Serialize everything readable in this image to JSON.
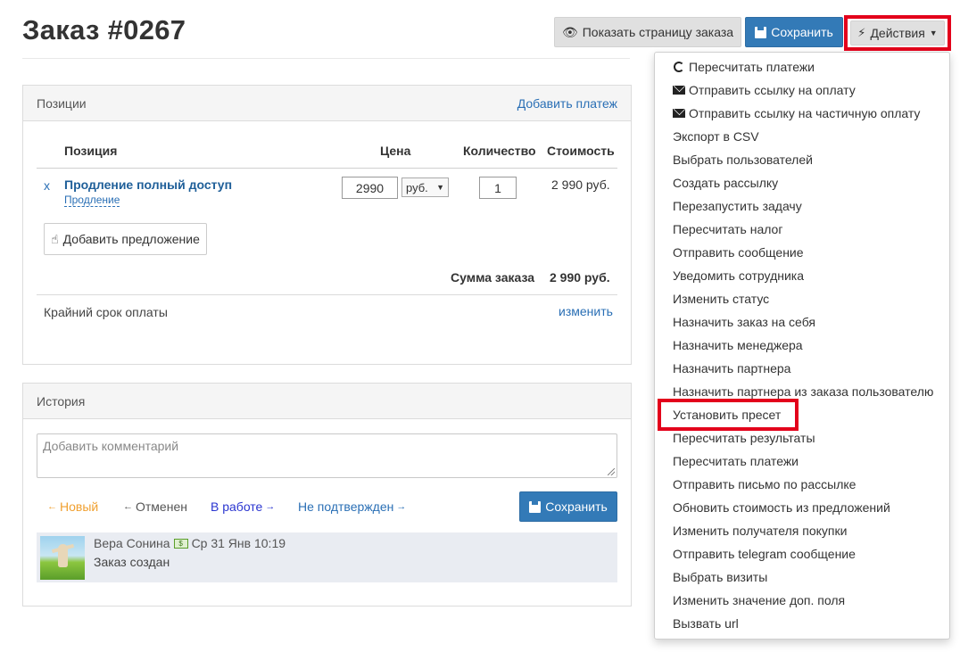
{
  "header": {
    "title": "Заказ #0267",
    "show_page_button": "Показать страницу заказа",
    "save_button": "Сохранить",
    "actions_button": "Действия"
  },
  "positions_panel": {
    "title": "Позиции",
    "add_payment_link": "Добавить платеж",
    "columns": {
      "position": "Позиция",
      "price": "Цена",
      "quantity": "Количество",
      "cost": "Стоимость"
    },
    "row": {
      "remove": "x",
      "name": "Продление полный доступ",
      "sub": "Продление",
      "price": "2990",
      "currency": "руб.",
      "quantity": "1",
      "cost": "2 990 руб."
    },
    "add_offer_button": "Добавить предложение",
    "total_label": "Сумма заказа",
    "total_value": "2 990 руб.",
    "deadline_label": "Крайний срок оплаты",
    "deadline_change": "изменить"
  },
  "history_panel": {
    "title": "История",
    "comment_placeholder": "Добавить комментарий",
    "statuses": {
      "new": "Новый",
      "cancelled": "Отменен",
      "in_progress": "В работе",
      "unconfirmed": "Не подтвержден"
    },
    "save_button": "Сохранить",
    "entry": {
      "author": "Вера Сонина",
      "time": "Ср 31 Янв 10:19",
      "text": "Заказ создан"
    }
  },
  "actions_menu": [
    "Пересчитать платежи",
    "Отправить ссылку на оплату",
    "Отправить ссылку на частичную оплату",
    "Экспорт в CSV",
    "Выбрать пользователей",
    "Создать рассылку",
    "Перезапустить задачу",
    "Пересчитать налог",
    "Отправить сообщение",
    "Уведомить сотрудника",
    "Изменить статус",
    "Назначить заказ на себя",
    "Назначить менеджера",
    "Назначить партнера",
    "Назначить партнера из заказа пользователю",
    "Установить пресет",
    "Пересчитать результаты",
    "Пересчитать платежи",
    "Отправить письмо по рассылке",
    "Обновить стоимость из предложений",
    "Изменить получателя покупки",
    "Отправить telegram сообщение",
    "Выбрать визиты",
    "Изменить значение доп. поля",
    "Вызвать url"
  ],
  "colors": {
    "primary": "#337ab7",
    "link": "#2a6fb5",
    "highlight": "#e3001b",
    "status_new": "#f0a030",
    "status_in_progress": "#2a35d0"
  }
}
